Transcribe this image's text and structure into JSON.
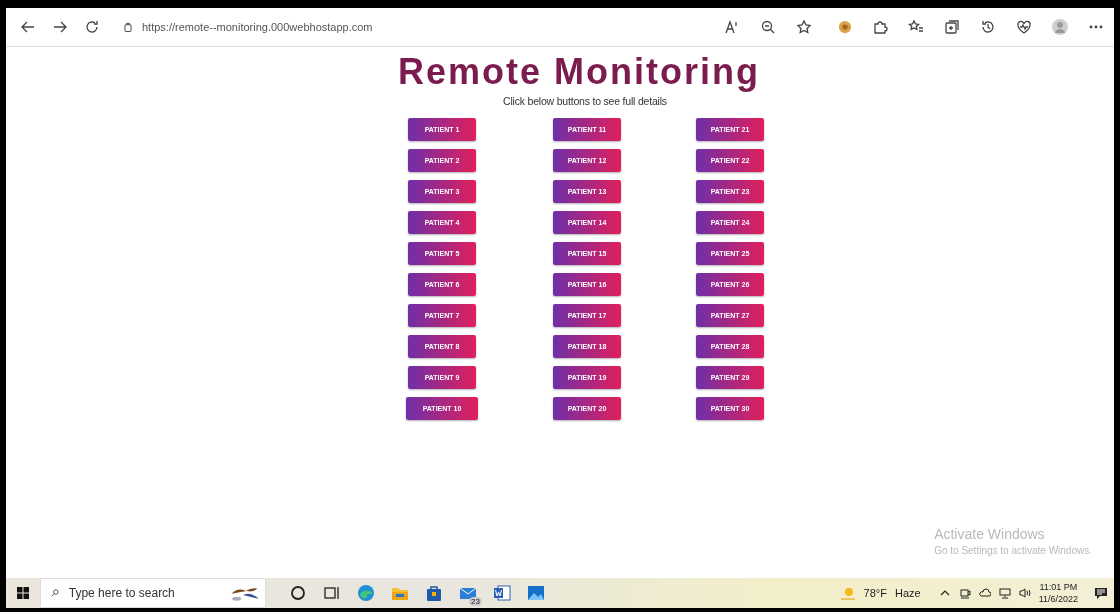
{
  "browser": {
    "url": "https://remote--monitoring.000webhostapp.com"
  },
  "page": {
    "title": "Remote Monitoring",
    "subtitle": "Click below buttons to see full details",
    "columns": [
      [
        "PATIENT 1",
        "PATIENT 2",
        "PATIENT 3",
        "PATIENT 4",
        "PATIENT 5",
        "PATIENT 6",
        "PATIENT 7",
        "PATIENT 8",
        "PATIENT 9",
        "PATIENT 10"
      ],
      [
        "PATIENT 11",
        "PATIENT 12",
        "PATIENT 13",
        "PATIENT 14",
        "PATIENT 15",
        "PATIENT 16",
        "PATIENT 17",
        "PATIENT 18",
        "PATIENT 19",
        "PATIENT 20"
      ],
      [
        "PATIENT 21",
        "PATIENT 22",
        "PATIENT 23",
        "PATIENT 24",
        "PATIENT 25",
        "PATIENT 26",
        "PATIENT 27",
        "PATIENT 28",
        "PATIENT 29",
        "PATIENT 30"
      ]
    ]
  },
  "activation_notice": {
    "title": "Activate Windows",
    "message": "Go to Settings to activate Windows."
  },
  "taskbar": {
    "search_placeholder": "Type here to search",
    "mail_badge": "23",
    "temperature": "78°F",
    "weather": "Haze",
    "time": "11:01 PM",
    "date": "11/6/2022"
  }
}
